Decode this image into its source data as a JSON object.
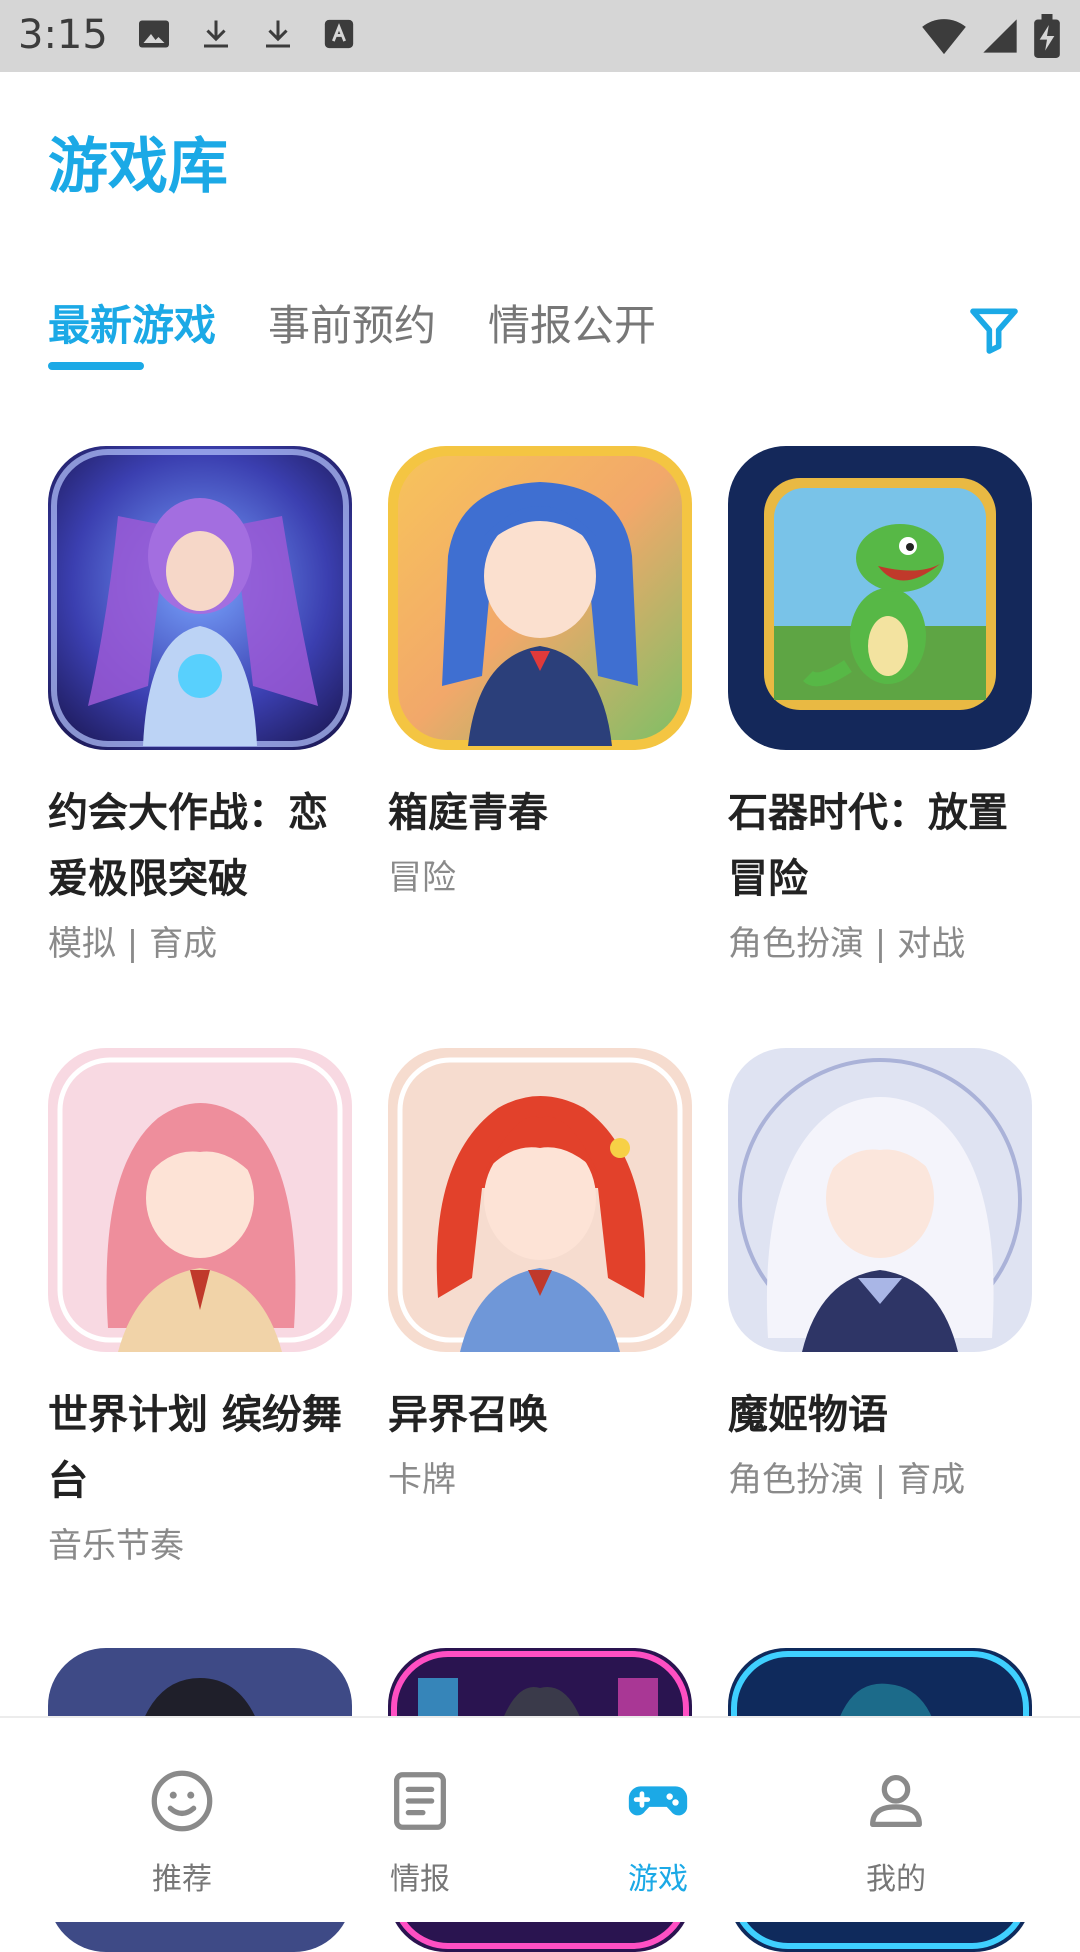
{
  "status_bar": {
    "time": "3:15",
    "left_icons": [
      "image-icon",
      "download-icon",
      "download-icon",
      "text-a-icon"
    ],
    "right_icons": [
      "wifi-icon",
      "signal-icon",
      "battery-charging-icon"
    ]
  },
  "page_title": "游戏库",
  "tabs": [
    {
      "label": "最新游戏",
      "active": true
    },
    {
      "label": "事前预约",
      "active": false
    },
    {
      "label": "情报公开",
      "active": false
    }
  ],
  "filter_icon": "filter-icon",
  "games": [
    {
      "title": "约会大作战：恋爱极限突破",
      "tags": "模拟 | 育成",
      "art": "mecha-girl-art"
    },
    {
      "title": "箱庭青春",
      "tags": "冒险",
      "art": "schoolgirl-art"
    },
    {
      "title": "石器时代：放置冒险",
      "tags": "角色扮演 | 对战",
      "art": "dinosaur-art"
    },
    {
      "title": "世界计划 缤纷舞台",
      "tags": "音乐节奏",
      "art": "pink-hair-girl-art"
    },
    {
      "title": "异界召唤",
      "tags": "卡牌",
      "art": "red-hair-girl-art"
    },
    {
      "title": "魔姬物语",
      "tags": "角色扮演 | 育成",
      "art": "white-hair-girl-art"
    }
  ],
  "partial_row_art": [
    "dark-hair-boy-art",
    "neon-city-art",
    "cyber-warrior-art"
  ],
  "nav": [
    {
      "label": "推荐",
      "icon": "smiley-icon",
      "active": false
    },
    {
      "label": "情报",
      "icon": "news-icon",
      "active": false
    },
    {
      "label": "游戏",
      "icon": "gamepad-icon",
      "active": true
    },
    {
      "label": "我的",
      "icon": "user-icon",
      "active": false
    }
  ],
  "colors": {
    "accent": "#1ba9e6",
    "status_bar": "#d6d6d6",
    "inactive": "#777777"
  }
}
